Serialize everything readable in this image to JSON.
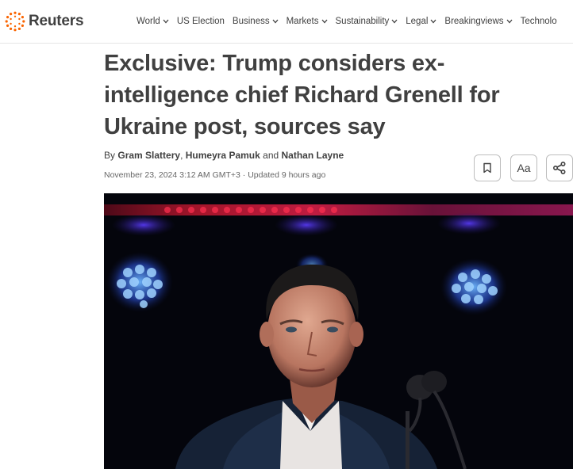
{
  "brand": {
    "name": "Reuters",
    "accent": "#fa6400"
  },
  "nav": {
    "items": [
      {
        "label": "World",
        "has_menu": true
      },
      {
        "label": "US Election",
        "has_menu": false
      },
      {
        "label": "Business",
        "has_menu": true
      },
      {
        "label": "Markets",
        "has_menu": true
      },
      {
        "label": "Sustainability",
        "has_menu": true
      },
      {
        "label": "Legal",
        "has_menu": true
      },
      {
        "label": "Breakingviews",
        "has_menu": true
      },
      {
        "label": "Technolo",
        "has_menu": false
      }
    ]
  },
  "article": {
    "headline": "Exclusive: Trump considers ex-intelligence chief Richard Grenell for Ukraine post, sources say",
    "byline": {
      "prefix": "By",
      "authors": [
        "Gram Slattery",
        "Humeyra Pamuk",
        "Nathan Layne"
      ],
      "separator": ",",
      "conjunction": "and"
    },
    "dateline": "November 23, 2024 3:12 AM GMT+3 · Updated 9 hours ago",
    "tools": {
      "bookmark_icon": "bookmark-icon",
      "text_size_label": "Aa",
      "share_icon": "share-icon"
    }
  }
}
